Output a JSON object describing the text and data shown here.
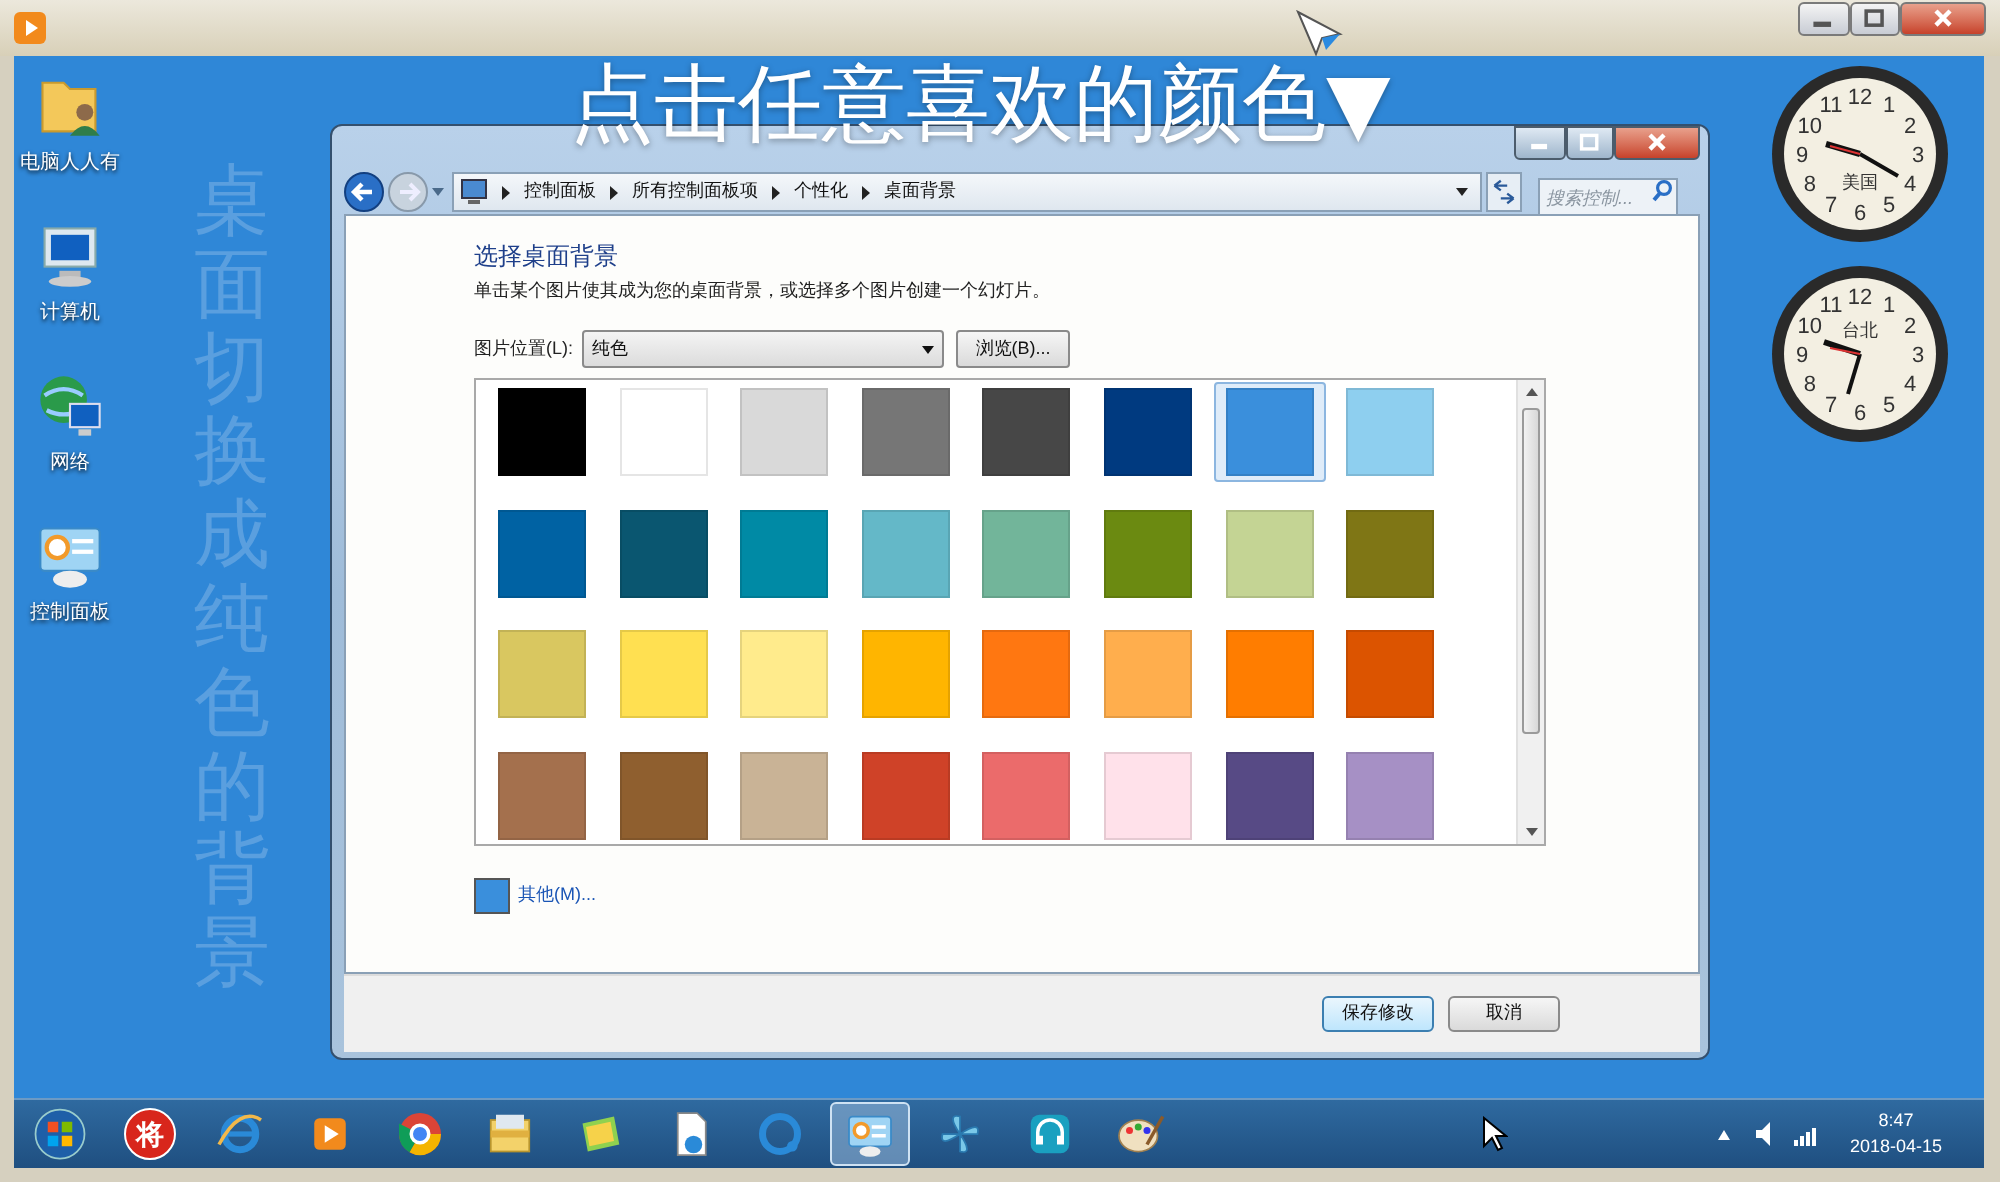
{
  "caption": "点击任意喜欢的颜色▼",
  "side_note": "桌面切换成纯色的背景",
  "desktop_icons": [
    {
      "kind": "user-folder",
      "label": "电脑人人有"
    },
    {
      "kind": "computer",
      "label": "计算机"
    },
    {
      "kind": "network",
      "label": "网络"
    },
    {
      "kind": "control-panel",
      "label": "控制面板"
    }
  ],
  "clocks": [
    {
      "label": "美国",
      "numerals": [
        "11",
        "12",
        "1",
        "10",
        "2",
        "9",
        "3",
        "8",
        "4",
        "7",
        "6",
        "5"
      ]
    },
    {
      "label": "台北",
      "numerals": [
        "11",
        "12",
        "1",
        "10",
        "2",
        "9",
        "3",
        "8",
        "4",
        "7",
        "6",
        "5"
      ]
    }
  ],
  "window": {
    "breadcrumbs": [
      "控制面板",
      "所有控制面板项",
      "个性化",
      "桌面背景"
    ],
    "search_placeholder": "搜索控制...",
    "heading": "选择桌面背景",
    "description": "单击某个图片使其成为您的桌面背景，或选择多个图片创建一个幻灯片。",
    "position_label": "图片位置(L):",
    "position_value": "纯色",
    "browse_button": "浏览(B)...",
    "swatches": [
      {
        "color": "#000000",
        "selected": false
      },
      {
        "color": "#ffffff",
        "selected": false
      },
      {
        "color": "#d9d9d9",
        "selected": false
      },
      {
        "color": "#767676",
        "selected": false
      },
      {
        "color": "#474747",
        "selected": false
      },
      {
        "color": "#003a80",
        "selected": false
      },
      {
        "color": "#3a8fdc",
        "selected": true
      },
      {
        "color": "#8ecfef",
        "selected": false
      },
      {
        "color": "#0062a3",
        "selected": false
      },
      {
        "color": "#0a5670",
        "selected": false
      },
      {
        "color": "#008aa5",
        "selected": false
      },
      {
        "color": "#64b8c8",
        "selected": false
      },
      {
        "color": "#72b59a",
        "selected": false
      },
      {
        "color": "#6b8a11",
        "selected": false
      },
      {
        "color": "#c4d494",
        "selected": false
      },
      {
        "color": "#7f7615",
        "selected": false
      },
      {
        "color": "#d9c760",
        "selected": false
      },
      {
        "color": "#ffe051",
        "selected": false
      },
      {
        "color": "#ffeb8c",
        "selected": false
      },
      {
        "color": "#ffb500",
        "selected": false
      },
      {
        "color": "#ff7711",
        "selected": false
      },
      {
        "color": "#ffae4d",
        "selected": false
      },
      {
        "color": "#ff7d00",
        "selected": false
      },
      {
        "color": "#dc5400",
        "selected": false
      },
      {
        "color": "#a4704d",
        "selected": false
      },
      {
        "color": "#8f5f2f",
        "selected": false
      },
      {
        "color": "#c9b396",
        "selected": false
      },
      {
        "color": "#cf4228",
        "selected": false
      },
      {
        "color": "#eb6b6b",
        "selected": false
      },
      {
        "color": "#ffe1ea",
        "selected": false
      },
      {
        "color": "#574a85",
        "selected": false
      },
      {
        "color": "#a690c5",
        "selected": false
      }
    ],
    "other": {
      "color": "#3a8fdc",
      "label": "其他(M)..."
    },
    "buttons": [
      "保存修改",
      "取消"
    ]
  },
  "taskbar": {
    "items": [
      {
        "kind": "start",
        "selected": false
      },
      {
        "kind": "glyph",
        "glyph": "将",
        "selected": false
      },
      {
        "kind": "ie",
        "selected": false
      },
      {
        "kind": "player",
        "selected": false
      },
      {
        "kind": "chrome",
        "selected": false
      },
      {
        "kind": "explorer",
        "selected": false
      },
      {
        "kind": "photos",
        "selected": false
      },
      {
        "kind": "document",
        "selected": false
      },
      {
        "kind": "ring",
        "selected": false
      },
      {
        "kind": "control-panel",
        "selected": true
      },
      {
        "kind": "pinwheel",
        "selected": false
      },
      {
        "kind": "headset",
        "selected": false
      },
      {
        "kind": "paint",
        "selected": false
      }
    ],
    "time": "8:47",
    "date": "2018-04-15"
  }
}
